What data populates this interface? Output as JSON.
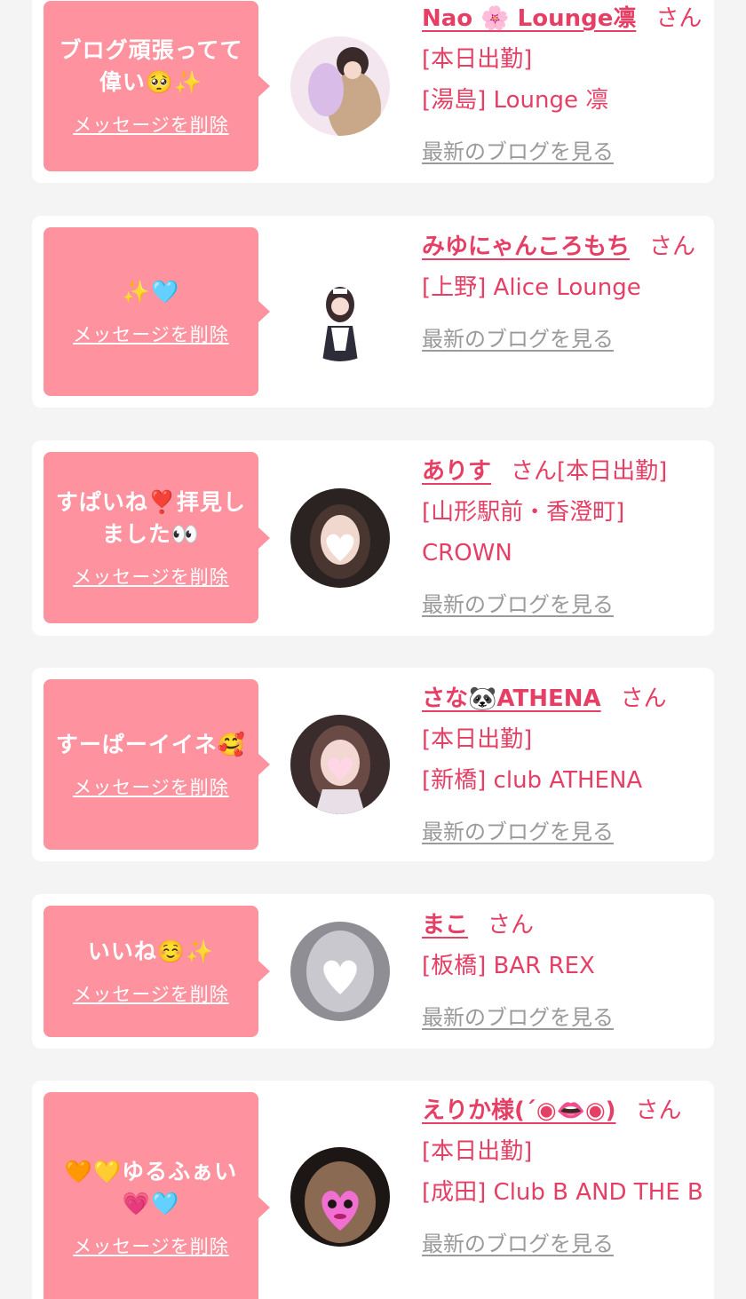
{
  "likes": [
    {
      "message": "ブログ頑張ってて偉い🥺✨",
      "delete_label": "メッセージを削除",
      "name": "Nao 🌸 Lounge凛",
      "honorific": "さん",
      "status": "[本日出勤]",
      "shop": "[湯島] Lounge 凛",
      "blog_link": "最新のブログを見る"
    },
    {
      "message": "✨🩵",
      "delete_label": "メッセージを削除",
      "name": "みゆにゃんころもち",
      "honorific": "さん",
      "status": "",
      "shop": "[上野] Alice Lounge",
      "blog_link": "最新のブログを見る"
    },
    {
      "message": "すぱいね❣️拝見しました👀",
      "delete_label": "メッセージを削除",
      "name": "ありす",
      "honorific": "さん",
      "status": "[本日出勤]",
      "shop": "[山形駅前・香澄町] CROWN",
      "blog_link": "最新のブログを見る"
    },
    {
      "message": "すーぱーイイネ🥰",
      "delete_label": "メッセージを削除",
      "name": "さな🐼ATHENA",
      "honorific": "さん",
      "status": "[本日出勤]",
      "shop": "[新橋] club ATHENA",
      "blog_link": "最新のブログを見る"
    },
    {
      "message": "いいね☺️✨",
      "delete_label": "メッセージを削除",
      "name": "まこ",
      "honorific": "さん",
      "status": "",
      "shop": "[板橋] BAR REX",
      "blog_link": "最新のブログを見る"
    },
    {
      "message": "🧡💛ゆるふぁい💗🩵",
      "delete_label": "メッセージを削除",
      "name": "えりか様(´◉👄◉)",
      "honorific": "さん",
      "status": "[本日出勤]",
      "shop": "[成田] Club B AND THE B",
      "blog_link": "最新のブログを見る"
    }
  ],
  "colors": {
    "accent": "#e63f66",
    "bubble": "#ff929f",
    "link_gray": "#9a9a9a",
    "background": "#f4f4f4"
  }
}
